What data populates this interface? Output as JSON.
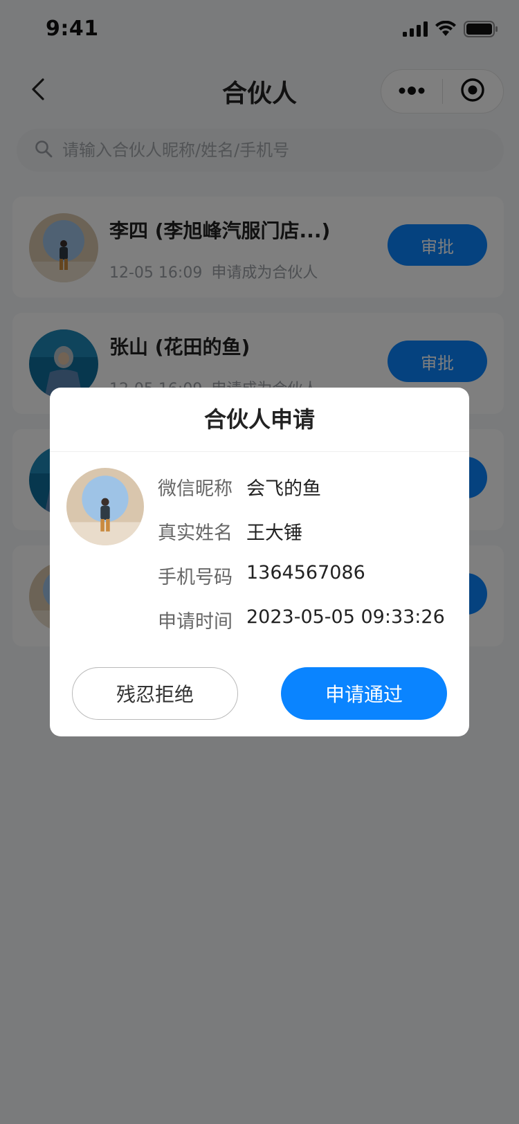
{
  "status_bar": {
    "time": "9:41",
    "icons": [
      "signal-icon",
      "wifi-icon",
      "battery-icon"
    ]
  },
  "nav": {
    "title": "合伙人",
    "back_icon": "chevron-left-icon",
    "more_icon": "more-dots-icon",
    "close_icon": "target-icon"
  },
  "search": {
    "placeholder": "请输入合伙人昵称/姓名/手机号",
    "icon": "search-icon"
  },
  "list": [
    {
      "name": "李四 (李旭峰汽服门店...)",
      "time": "12-05 16:09",
      "desc": "申请成为合伙人",
      "action": "审批",
      "avatar": "avatar-sitting-man"
    },
    {
      "name": "张山 (花田的鱼)",
      "time": "12-05 16:09",
      "desc": "申请成为合伙人",
      "action": "审批",
      "avatar": "avatar-hoodie-woman"
    },
    {
      "name": "",
      "time": "",
      "desc": "",
      "action": "审批",
      "avatar": "avatar-hoodie-woman"
    },
    {
      "name": "",
      "time": "",
      "desc": "",
      "action": "审批",
      "avatar": "avatar-sitting-man"
    }
  ],
  "dialog": {
    "title": "合伙人申请",
    "avatar": "avatar-sitting-man",
    "fields": [
      {
        "label": "微信昵称",
        "value": "会飞的鱼"
      },
      {
        "label": "真实姓名",
        "value": "王大锤"
      },
      {
        "label": "手机号码",
        "value": "1364567086"
      },
      {
        "label": "申请时间",
        "value": "2023-05-05 09:33:26"
      }
    ],
    "reject_label": "残忍拒绝",
    "approve_label": "申请通过"
  },
  "colors": {
    "primary": "#0a84ff",
    "background": "#f5f6f8",
    "overlay": "rgba(0,0,0,0.5)"
  }
}
